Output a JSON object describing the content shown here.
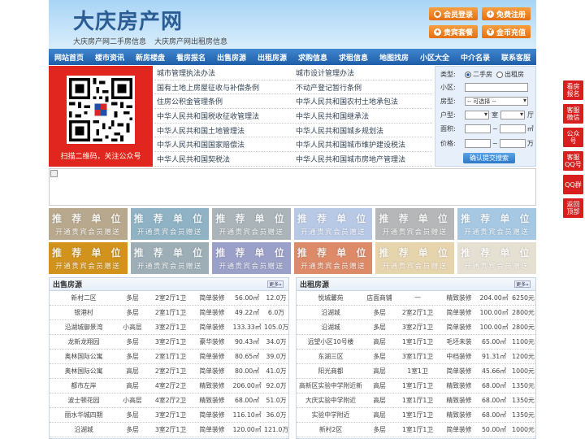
{
  "header": {
    "logo": "大庆房产网",
    "sub": [
      "大庆房产网二手房信息",
      "大庆房产网出租房信息"
    ],
    "buttons": [
      {
        "label": "会员登录",
        "icon": "user-icon"
      },
      {
        "label": "免费注册",
        "icon": "user-add-icon"
      },
      {
        "label": "贵宾套餐",
        "icon": "vip-icon"
      },
      {
        "label": "金币充值",
        "icon": "coin-icon"
      }
    ]
  },
  "nav": [
    "网站首页",
    "楼市资讯",
    "新房楼盘",
    "看房报名",
    "出售房源",
    "出租房源",
    "求购信息",
    "求租信息",
    "地图找房",
    "小区大全",
    "中介名录",
    "联系客服"
  ],
  "qr": {
    "caption": "扫描二维码，关注公众号"
  },
  "links": [
    [
      "城市管理执法办法",
      "城市设计管理办法"
    ],
    [
      "国有土地上房屋征收与补偿条例",
      "不动产登记暂行条例"
    ],
    [
      "住房公积金管理条例",
      "中华人民共和国农村土地承包法"
    ],
    [
      "中华人民共和国税收征收管理法",
      "中华人民共和国继承法"
    ],
    [
      "中华人民共和国土地管理法",
      "中华人民共和国城乡规划法"
    ],
    [
      "中华人民共和国国家赔偿法",
      "中华人民共和国城市维护建设税法"
    ],
    [
      "中华人民共和国契税法",
      "中华人民共和国城市房地产管理法"
    ]
  ],
  "search": {
    "type_label": "类型:",
    "opt1": "二手房",
    "opt2": "出租房",
    "area_label": "小区:",
    "room_label": "房型:",
    "room_select": "-- 可选择 --",
    "layout_label": "户型:",
    "shi": "室",
    "ting": "厅",
    "size_label": "面积:",
    "size_unit": "㎡",
    "price_label": "价格:",
    "price_unit": "万",
    "tilde": "~",
    "submit": "确认提交搜索"
  },
  "rec": {
    "t1": "推 荐 单 位",
    "t2": "开通贵宾会员赠送",
    "colors": [
      "#b8a98e",
      "#8fb3c4",
      "#aab4b9",
      "#b8c9e6",
      "#b6b7b8",
      "#a6c8e3",
      "#d1931c",
      "#9eaeb6",
      "#9aa0c8",
      "#dd8a69",
      "#e6d4ad",
      "#e6e0d2"
    ]
  },
  "sale": {
    "title": "出售房源",
    "more": "更多»",
    "rows": [
      [
        "新村二区",
        "多层",
        "2室2厅1卫",
        "简单装修",
        "56.00㎡",
        "12.0万"
      ],
      [
        "银港村",
        "多层",
        "2室1厅1卫",
        "简单装修",
        "49.22㎡",
        "6.0万"
      ],
      [
        "沿湖城御景湾",
        "小高层",
        "3室2厅1卫",
        "简单装修",
        "133.33㎡",
        "105.0万"
      ],
      [
        "龙新龙翔园",
        "多层",
        "3室2厅1卫",
        "豪华装修",
        "90.43㎡",
        "34.0万"
      ],
      [
        "奥林国际公寓",
        "多层",
        "2室1厅1卫",
        "简单装修",
        "80.65㎡",
        "39.0万"
      ],
      [
        "奥林国际公寓",
        "高层",
        "2室2厅1卫",
        "简单装修",
        "80.00㎡",
        "41.0万"
      ],
      [
        "都市左岸",
        "高层",
        "4室2厅2卫",
        "精致装修",
        "206.00㎡",
        "92.0万"
      ],
      [
        "波士顿花园",
        "小高层",
        "4室2厅2卫",
        "精致装修",
        "68.00㎡",
        "51.0万"
      ],
      [
        "丽水华城四期",
        "多层",
        "3室2厅1卫",
        "简单装修",
        "116.10㎡",
        "36.0万"
      ],
      [
        "沿湖城",
        "多层",
        "3室2厅1卫",
        "简单装修",
        "120.00㎡",
        "121.0万"
      ]
    ]
  },
  "rent": {
    "title": "出租房源",
    "more": "更多»",
    "rows": [
      [
        "悦城馨苑",
        "店面商铺",
        "一",
        "精致装修",
        "204.00㎡",
        "6250元"
      ],
      [
        "沿湖城",
        "多层",
        "2室2厅1卫",
        "简单装修",
        "100.00㎡",
        "2800元"
      ],
      [
        "沿湖城",
        "多层",
        "3室2厅1卫",
        "简单装修",
        "100.00㎡",
        "2800元"
      ],
      [
        "远望小区10号楼",
        "高层",
        "1室1厅1卫",
        "毛坯未装",
        "65.00㎡",
        "1100元"
      ],
      [
        "东湖三区",
        "多层",
        "3室1厅1卫",
        "中档装修",
        "91.31㎡",
        "1200元"
      ],
      [
        "阳光商都",
        "高层",
        "1室1卫",
        "简单装修",
        "45.66㎡",
        "1000元"
      ],
      [
        "高新区实验中学附近新",
        "高层",
        "1室1厅1卫",
        "精致装修",
        "68.00㎡",
        "1350元"
      ],
      [
        "大庆实验中学附近",
        "高层",
        "1室1厅1卫",
        "精致装修",
        "68.00㎡",
        "1350元"
      ],
      [
        "实验中学附近",
        "高层",
        "1室1厅1卫",
        "精致装修",
        "68.00㎡",
        "1350元"
      ],
      [
        "新村2区",
        "多层",
        "1室1厅1卫",
        "简单装修",
        "50.00㎡",
        "1000元"
      ]
    ]
  },
  "side": [
    "看房报名",
    "客服微信",
    "公众号",
    "客服QQ号",
    "QQ群",
    "返回顶部"
  ]
}
